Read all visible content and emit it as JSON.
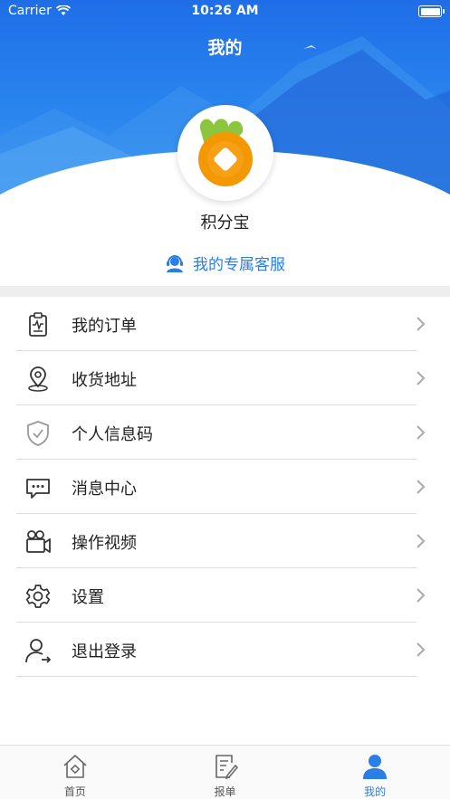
{
  "status_bar": {
    "carrier": "Carrier",
    "time": "10:26 AM"
  },
  "header": {
    "title": "我的"
  },
  "profile": {
    "name": "积分宝",
    "avatar_icon": "carrot-coin-logo"
  },
  "service": {
    "label": "我的专属客服",
    "icon": "headset-agent-icon"
  },
  "menu": [
    {
      "label": "我的订单",
      "icon": "clipboard-icon"
    },
    {
      "label": "收货地址",
      "icon": "location-pin-icon"
    },
    {
      "label": "个人信息码",
      "icon": "shield-check-icon"
    },
    {
      "label": "消息中心",
      "icon": "chat-bubble-icon"
    },
    {
      "label": "操作视频",
      "icon": "video-camera-icon"
    },
    {
      "label": "设置",
      "icon": "gear-icon"
    },
    {
      "label": "退出登录",
      "icon": "user-logout-icon"
    }
  ],
  "tabbar": [
    {
      "label": "首页",
      "icon": "home-icon",
      "active": false
    },
    {
      "label": "报单",
      "icon": "edit-document-icon",
      "active": false
    },
    {
      "label": "我的",
      "icon": "user-icon",
      "active": true
    }
  ],
  "colors": {
    "accent": "#2a7ee6",
    "header_top": "#1f6ee8",
    "divider": "#eeeeee",
    "logo_green": "#8cc63f",
    "logo_orange": "#f39800"
  }
}
